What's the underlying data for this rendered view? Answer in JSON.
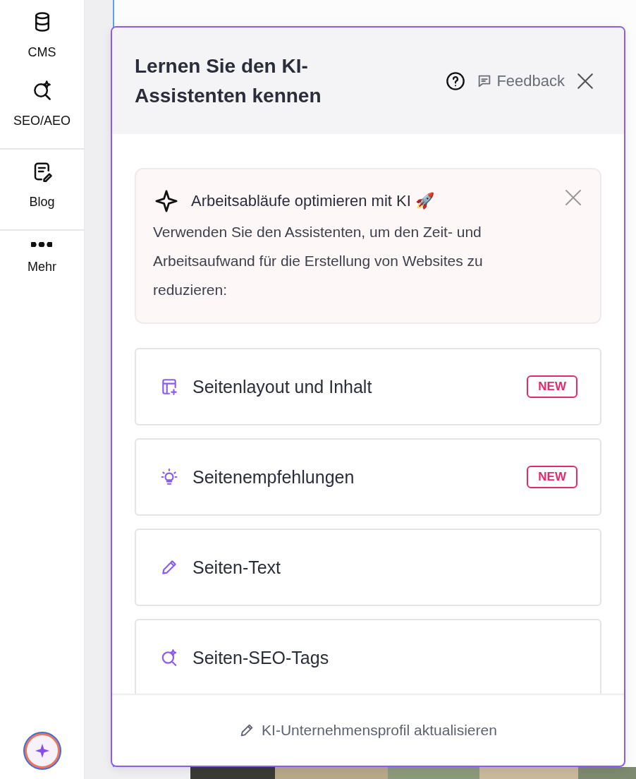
{
  "sidebar": {
    "groups": [
      {
        "items": [
          {
            "kind": "cms",
            "label": "CMS"
          },
          {
            "kind": "seo",
            "label": "SEO/AEO"
          }
        ]
      },
      {
        "items": [
          {
            "kind": "blog",
            "label": "Blog"
          }
        ]
      },
      {
        "items": [
          {
            "kind": "more",
            "label": "Mehr"
          }
        ]
      }
    ]
  },
  "panel": {
    "title": "Lernen Sie den KI-Assistenten kennen",
    "feedback": "Feedback",
    "intro": {
      "title": "Arbeitsabläufe optimieren mit KI 🚀",
      "text": "Verwenden Sie den Assistenten, um den Zeit- und Arbeitsaufwand für die Erstellung von Websites zu reduzieren:"
    },
    "tools": [
      {
        "kind": "layout",
        "label": "Seitenlayout und Inhalt",
        "badge": "NEW"
      },
      {
        "kind": "bulb",
        "label": "Seitenempfehlungen",
        "badge": "NEW"
      },
      {
        "kind": "pencil",
        "label": "Seiten-Text"
      },
      {
        "kind": "seo",
        "label": "Seiten-SEO-Tags"
      }
    ],
    "footer_link": "KI-Unternehmensprofil aktualisieren"
  }
}
